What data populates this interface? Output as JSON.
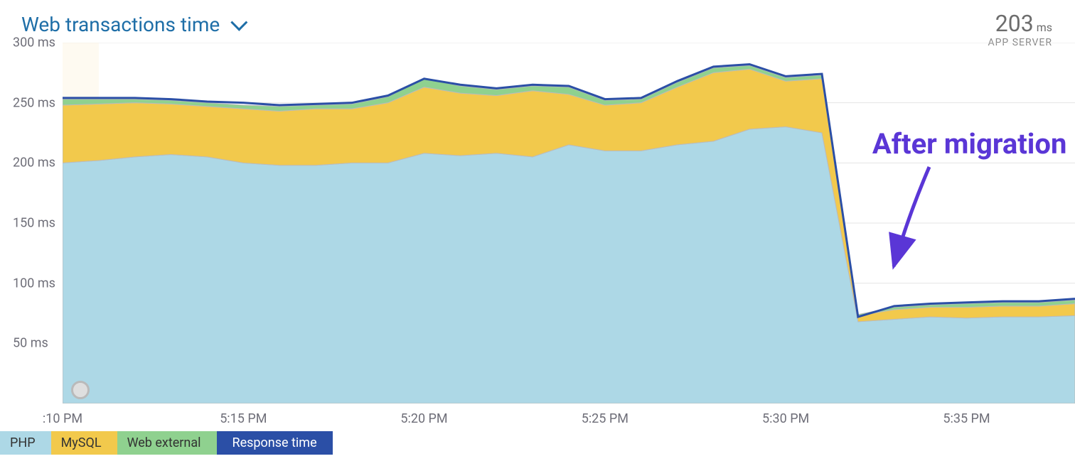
{
  "title": "Web transactions time",
  "summary": {
    "value": "203",
    "unit": "ms",
    "subtitle": "APP SERVER"
  },
  "y_axis": {
    "min": 0,
    "max": 300,
    "ticks": [
      50,
      100,
      150,
      200,
      250,
      300
    ],
    "unit": "ms"
  },
  "x_axis": {
    "ticks": [
      ":10 PM",
      "5:15 PM",
      "5:20 PM",
      "5:25 PM",
      "5:30 PM",
      "5:35 PM"
    ],
    "tick_positions": [
      0,
      5,
      10,
      15,
      20,
      25
    ]
  },
  "legend": [
    {
      "name": "PHP",
      "color": "#add8e6"
    },
    {
      "name": "MySQL",
      "color": "#f2c94c"
    },
    {
      "name": "Web external",
      "color": "#8fd18f"
    },
    {
      "name": "Response time",
      "color": "#2b4fa6"
    }
  ],
  "annotation": {
    "text": "After migration",
    "x_index": 22,
    "y_value": 85
  },
  "chart_data": {
    "type": "area",
    "title": "Web transactions time",
    "xlabel": "",
    "ylabel": "ms",
    "ylim": [
      0,
      300
    ],
    "x": [
      0,
      1,
      2,
      3,
      4,
      5,
      6,
      7,
      8,
      9,
      10,
      11,
      12,
      13,
      14,
      15,
      16,
      17,
      18,
      19,
      20,
      21,
      22,
      23,
      24,
      25,
      26,
      27,
      28
    ],
    "series": [
      {
        "name": "PHP",
        "color": "#add8e6",
        "values": [
          200,
          202,
          205,
          207,
          205,
          200,
          198,
          198,
          200,
          200,
          208,
          206,
          208,
          205,
          215,
          210,
          210,
          215,
          218,
          228,
          230,
          225,
          68,
          70,
          72,
          71,
          72,
          72,
          73
        ]
      },
      {
        "name": "MySQL",
        "color": "#f2c94c",
        "values": [
          48,
          47,
          45,
          42,
          42,
          45,
          45,
          47,
          45,
          50,
          55,
          52,
          48,
          55,
          42,
          38,
          40,
          48,
          57,
          50,
          38,
          45,
          5,
          8,
          8,
          9,
          9,
          9,
          10
        ]
      },
      {
        "name": "Web external",
        "color": "#8fd18f",
        "values": [
          5,
          4,
          3,
          3,
          3,
          3,
          4,
          3,
          4,
          5,
          7,
          6,
          5,
          4,
          6,
          4,
          3,
          4,
          4,
          3,
          3,
          3,
          1,
          2,
          2,
          3,
          3,
          3,
          3
        ]
      }
    ],
    "response_time": [
      254,
      254,
      254,
      253,
      251,
      250,
      248,
      249,
      250,
      256,
      270,
      265,
      262,
      265,
      264,
      253,
      254,
      268,
      280,
      282,
      272,
      274,
      72,
      81,
      83,
      84,
      85,
      85,
      87
    ]
  }
}
